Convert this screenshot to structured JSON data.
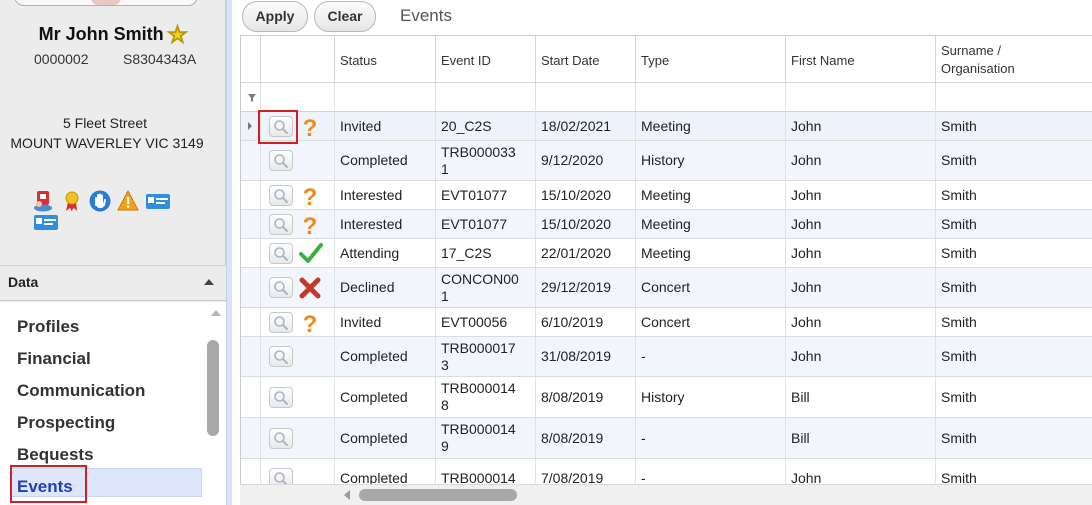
{
  "contact": {
    "name": "Mr John Smith",
    "id": "0000002",
    "code": "S8304343A",
    "address_line1": "5 Fleet Street",
    "address_line2": "MOUNT WAVERLEY VIC 3149"
  },
  "flags": [
    "id-card-icon",
    "award-ribbon-icon",
    "hand-stop-icon",
    "warning-icon",
    "card-icon",
    "card-icon"
  ],
  "left_panel": {
    "section_title": "Data",
    "nav_items": [
      "Profiles",
      "Financial",
      "Communication",
      "Prospecting",
      "Bequests",
      "Events"
    ],
    "selected_item": "Events"
  },
  "toolbar": {
    "apply_label": "Apply",
    "clear_label": "Clear",
    "title": "Events"
  },
  "grid": {
    "columns": [
      "Status",
      "Event ID",
      "Start Date",
      "Type",
      "First Name",
      "Surname /\nOrganisation"
    ],
    "rows": [
      {
        "icon": "question",
        "status": "Invited",
        "event_id": "20_C2S",
        "start_date": "18/02/2021",
        "type": "Meeting",
        "first_name": "John",
        "surname": "Smith"
      },
      {
        "icon": "",
        "status": "Completed",
        "event_id": "TRB000033\n1",
        "start_date": "9/12/2020",
        "type": "History",
        "first_name": "John",
        "surname": "Smith"
      },
      {
        "icon": "question",
        "status": "Interested",
        "event_id": "EVT01077",
        "start_date": "15/10/2020",
        "type": "Meeting",
        "first_name": "John",
        "surname": "Smith"
      },
      {
        "icon": "question",
        "status": "Interested",
        "event_id": "EVT01077",
        "start_date": "15/10/2020",
        "type": "Meeting",
        "first_name": "John",
        "surname": "Smith"
      },
      {
        "icon": "check",
        "status": "Attending",
        "event_id": "17_C2S",
        "start_date": "22/01/2020",
        "type": "Meeting",
        "first_name": "John",
        "surname": "Smith"
      },
      {
        "icon": "cross",
        "status": "Declined",
        "event_id": "CONCON00\n1",
        "start_date": "29/12/2019",
        "type": "Concert",
        "first_name": "John",
        "surname": "Smith"
      },
      {
        "icon": "question",
        "status": "Invited",
        "event_id": "EVT00056",
        "start_date": "6/10/2019",
        "type": "Concert",
        "first_name": "John",
        "surname": "Smith"
      },
      {
        "icon": "",
        "status": "Completed",
        "event_id": "TRB000017\n3",
        "start_date": "31/08/2019",
        "type": "-",
        "first_name": "John",
        "surname": "Smith"
      },
      {
        "icon": "",
        "status": "Completed",
        "event_id": "TRB000014\n8",
        "start_date": "8/08/2019",
        "type": "History",
        "first_name": "Bill",
        "surname": "Smith"
      },
      {
        "icon": "",
        "status": "Completed",
        "event_id": "TRB000014\n9",
        "start_date": "8/08/2019",
        "type": "-",
        "first_name": "Bill",
        "surname": "Smith"
      },
      {
        "icon": "",
        "status": "Completed",
        "event_id": "TRB000014\n",
        "start_date": "7/08/2019",
        "type": "-",
        "first_name": "John",
        "surname": "Smith"
      }
    ]
  },
  "colors": {
    "highlight": "#d21f1f",
    "selected_nav_bg": "#dde6fa",
    "selected_nav_text": "#1f3fbf",
    "question": "#f08a1c",
    "check": "#3cb043",
    "cross": "#c0392b"
  }
}
